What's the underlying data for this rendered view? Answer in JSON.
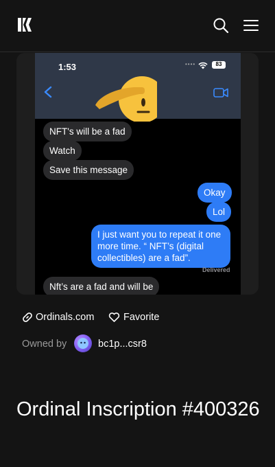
{
  "header": {
    "logo_icon": "grid-brand-logo",
    "search_icon": "search-icon",
    "menu_icon": "hamburger-menu-icon"
  },
  "chat": {
    "status_time": "1:53",
    "battery": "83",
    "emoji": "saluting-face",
    "messages": [
      {
        "from": "them",
        "text": "NFT's will be a fad"
      },
      {
        "from": "them",
        "text": "Watch"
      },
      {
        "from": "them",
        "text": "Save this message"
      },
      {
        "from": "me",
        "text": "Okay"
      },
      {
        "from": "me",
        "text": "Lol"
      },
      {
        "from": "me",
        "text": "I just want you to repeat it one more time. “ NFT’s (digital collectibles) are a fad”."
      },
      {
        "from": "them",
        "text": "Nft’s are a fad and will be"
      }
    ],
    "delivered_label": "Delivered"
  },
  "meta": {
    "site_link": "Ordinals.com",
    "favorite_label": "Favorite",
    "owned_by_label": "Owned by",
    "owner_address": "bc1p...csr8"
  },
  "page_title": "Ordinal Inscription #400326"
}
